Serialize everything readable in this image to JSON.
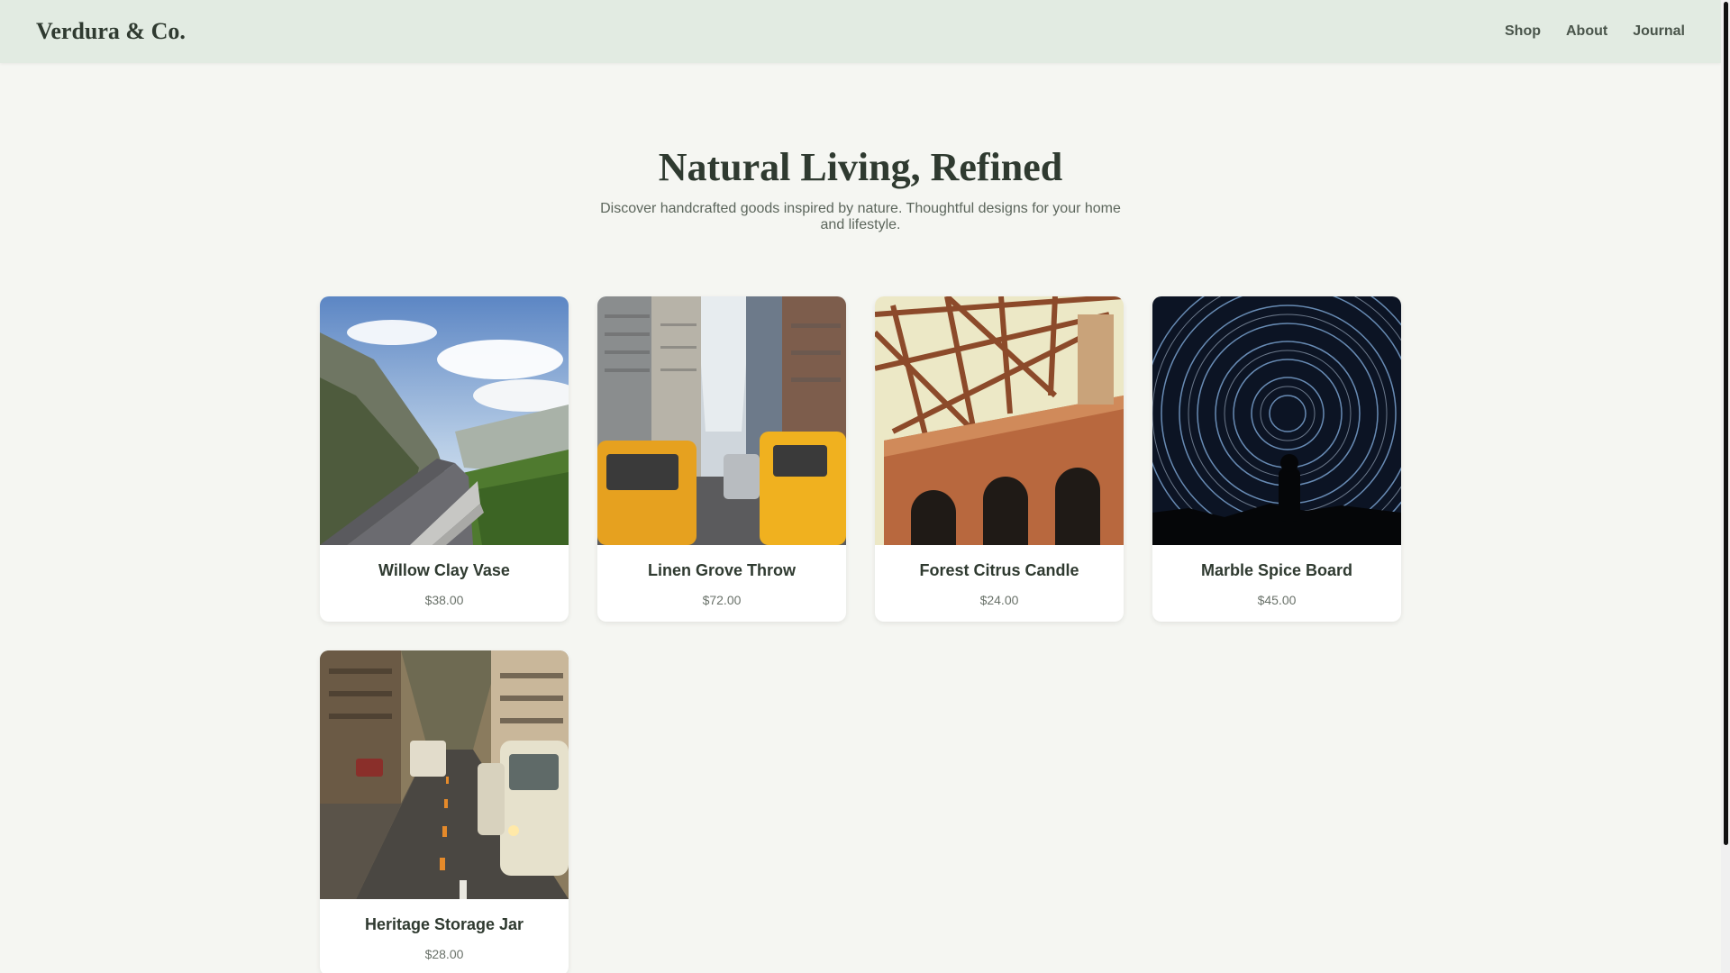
{
  "header": {
    "brand": "Verdura & Co.",
    "nav": [
      "Shop",
      "About",
      "Journal"
    ]
  },
  "hero": {
    "title": "Natural Living, Refined",
    "subtitle": "Discover handcrafted goods inspired by nature. Thoughtful designs for your home and lifestyle."
  },
  "products": [
    {
      "name": "Willow Clay Vase",
      "price": "$38.00",
      "image": "mountain-road-photo"
    },
    {
      "name": "Linen Grove Throw",
      "price": "$72.00",
      "image": "city-taxis-photo"
    },
    {
      "name": "Forest Citrus Candle",
      "price": "$24.00",
      "image": "steel-bridge-photo"
    },
    {
      "name": "Marble Spice Board",
      "price": "$45.00",
      "image": "star-trails-photo"
    },
    {
      "name": "Heritage Storage Jar",
      "price": "$28.00",
      "image": "street-traffic-photo"
    }
  ],
  "colors": {
    "header_bg": "#e2ebe2",
    "page_bg": "#f5f6f2",
    "text": "#2f3a30"
  }
}
